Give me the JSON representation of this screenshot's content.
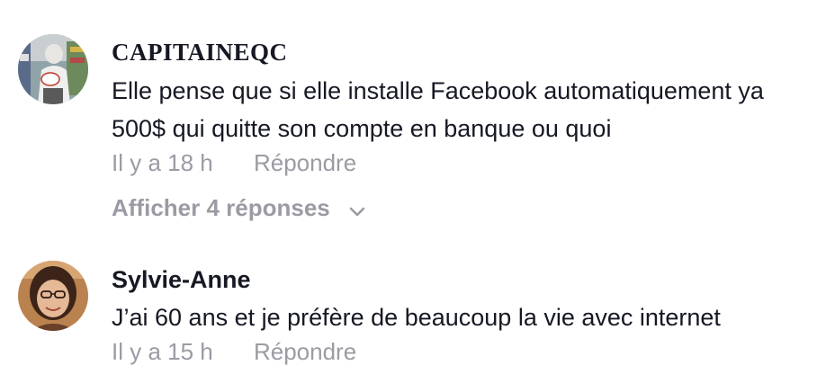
{
  "comments": [
    {
      "author": "CAPITAINEQC",
      "text": "Elle pense que si elle installe Facebook automatiquement ya 500$ qui quitte son compte en banque ou quoi",
      "time": "Il y a 18 h",
      "reply_label": "Répondre",
      "show_replies_label": "Afficher 4 réponses",
      "show_replies_icon": "chevron-down-icon"
    },
    {
      "author": "Sylvie-Anne",
      "text": "J’ai 60 ans et je préfère de beaucoup la vie avec internet",
      "time": "Il y a 15 h",
      "reply_label": "Répondre"
    }
  ],
  "colors": {
    "primary_text": "#161823",
    "secondary_text": "#9a9ba3",
    "background": "#ffffff"
  }
}
